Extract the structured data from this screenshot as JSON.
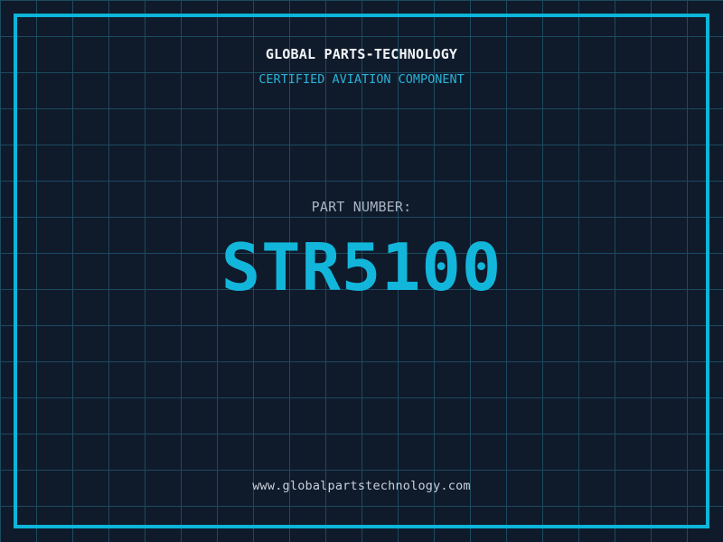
{
  "colors": {
    "background": "#0f1a2b",
    "grid_line": "#1d4a5f",
    "frame": "#0cb5d9",
    "title": "#f2f5f8",
    "subtitle": "#2bb2d6",
    "label": "#aab3c0",
    "part_number": "#12b6da",
    "url": "#c9d1da"
  },
  "header": {
    "title": "GLOBAL PARTS-TECHNOLOGY",
    "subtitle": "CERTIFIED AVIATION COMPONENT"
  },
  "part": {
    "label": "PART NUMBER:",
    "number": "STR5100"
  },
  "footer": {
    "url": "www.globalpartstechnology.com"
  }
}
